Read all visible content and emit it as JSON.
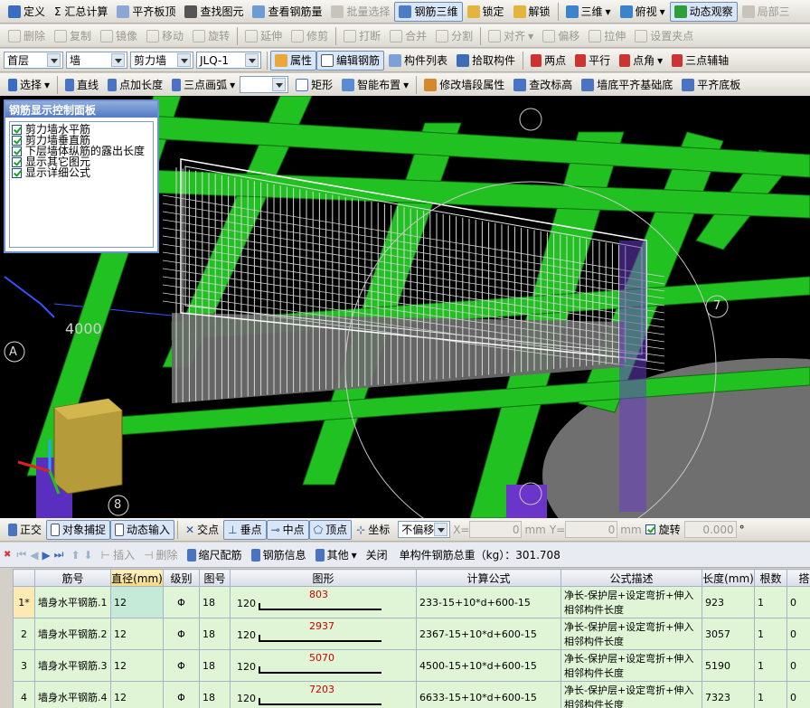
{
  "toolbar1": [
    {
      "label": "定义",
      "icon": "define-icon",
      "state": "normal"
    },
    {
      "label": "Σ 汇总计算",
      "icon": "",
      "state": "normal"
    },
    {
      "label": "平齐板顶",
      "icon": "align-slab-icon",
      "state": "normal"
    },
    {
      "label": "查找图元",
      "icon": "binoculars-icon",
      "state": "normal"
    },
    {
      "label": "查看钢筋量",
      "icon": "rebar-qty-icon",
      "state": "normal"
    },
    {
      "label": "批量选择",
      "icon": "batch-select-icon",
      "state": "disabled"
    },
    {
      "label": "钢筋三维",
      "icon": "rebar-3d-icon",
      "state": "active"
    },
    {
      "label": "锁定",
      "icon": "lock-icon",
      "state": "normal"
    },
    {
      "label": "解锁",
      "icon": "unlock-icon",
      "state": "normal"
    },
    {
      "label": "三维",
      "icon": "cube-3d-icon",
      "state": "dropdown"
    },
    {
      "label": "俯视",
      "icon": "top-view-icon",
      "state": "dropdown"
    },
    {
      "label": "动态观察",
      "icon": "orbit-icon",
      "state": "active"
    },
    {
      "label": "局部三",
      "icon": "local-3d-icon",
      "state": "disabled"
    }
  ],
  "toolbar2": [
    "删除",
    "复制",
    "镜像",
    "移动",
    "旋转",
    "延伸",
    "修剪",
    "打断",
    "合并",
    "分割",
    "对齐",
    "偏移",
    "拉伸",
    "设置夹点"
  ],
  "toolbar3": {
    "floor": "首层",
    "category": "墙",
    "type": "剪力墙",
    "element": "JLQ-1",
    "buttons": [
      "属性",
      "编辑钢筋",
      "构件列表",
      "拾取构件",
      "两点",
      "平行",
      "点角",
      "三点辅轴"
    ]
  },
  "toolbar4": [
    "选择",
    "直线",
    "点加长度",
    "三点画弧",
    "",
    "矩形",
    "智能布置",
    "修改墙段属性",
    "查改标高",
    "墙底平齐基础底",
    "平齐底板"
  ],
  "control_panel": {
    "title": "钢筋显示控制面板",
    "items": [
      "剪力墙水平筋",
      "剪力墙垂直筋",
      "下层墙体纵筋的露出长度",
      "显示其它图元",
      "显示详细公式"
    ]
  },
  "viewport": {
    "dimension_label": "4000",
    "axis_A": "A",
    "axis_8": "8",
    "axis_7": "7"
  },
  "snapbar": {
    "buttons": [
      "正交",
      "对象捕捉",
      "动态输入",
      "交点",
      "垂点",
      "中点",
      "顶点",
      "坐标"
    ],
    "offset_mode": "不偏移",
    "x_label": "X=",
    "x_value": "0",
    "y_label": "Y=",
    "y_value": "0",
    "unit": "mm",
    "rotate_label": "旋转",
    "rotate_value": "0.000",
    "degree": "°"
  },
  "tablebar": {
    "buttons": [
      "插入",
      "删除",
      "缩尺配筋",
      "钢筋信息",
      "其他",
      "关闭"
    ],
    "total": "单构件钢筋总重（kg）：301.708"
  },
  "table": {
    "headers": [
      "",
      "筋号",
      "直径(mm)",
      "级别",
      "图号",
      "图形",
      "计算公式",
      "公式描述",
      "长度(mm)",
      "根数",
      "搭接"
    ],
    "rows": [
      {
        "idx": "1*",
        "name": "墙身水平钢筋.1",
        "dia": "12",
        "grade": "Φ",
        "fig": "18",
        "left": "120",
        "shape": "803",
        "formula": "233-15+10*d+600-15",
        "desc": "净长-保护层+设定弯折+伸入相邻构件长度",
        "len": "923",
        "count": "1",
        "lap": "0"
      },
      {
        "idx": "2",
        "name": "墙身水平钢筋.2",
        "dia": "12",
        "grade": "Φ",
        "fig": "18",
        "left": "120",
        "shape": "2937",
        "formula": "2367-15+10*d+600-15",
        "desc": "净长-保护层+设定弯折+伸入相邻构件长度",
        "len": "3057",
        "count": "1",
        "lap": "0"
      },
      {
        "idx": "3",
        "name": "墙身水平钢筋.3",
        "dia": "12",
        "grade": "Φ",
        "fig": "18",
        "left": "120",
        "shape": "5070",
        "formula": "4500-15+10*d+600-15",
        "desc": "净长-保护层+设定弯折+伸入相邻构件长度",
        "len": "5190",
        "count": "1",
        "lap": "0"
      },
      {
        "idx": "4",
        "name": "墙身水平钢筋.4",
        "dia": "12",
        "grade": "Φ",
        "fig": "18",
        "left": "120",
        "shape": "7203",
        "formula": "6633-15+10*d+600-15",
        "desc": "净长-保护层+设定弯折+伸入相邻构件长度",
        "len": "7323",
        "count": "1",
        "lap": "0"
      }
    ]
  },
  "colors": {
    "viewport_bg": "#000000",
    "beam_green": "#22c122",
    "table_row": "#dff5d6",
    "shape_value_red": "#cc0000"
  }
}
